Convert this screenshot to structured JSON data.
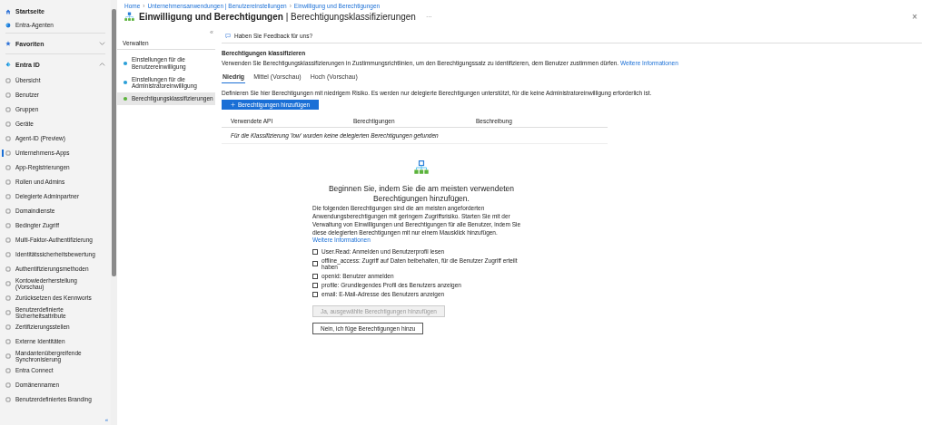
{
  "sidebar": {
    "top_items": [
      {
        "label": "Startseite",
        "kind": "home"
      },
      {
        "label": "Entra-Agenten",
        "kind": "agent"
      }
    ],
    "favorites": {
      "label": "Favoriten",
      "expanded": false
    },
    "section": {
      "label": "Entra ID",
      "expanded": true
    },
    "items": [
      {
        "label": "Übersicht",
        "selected": false
      },
      {
        "label": "Benutzer",
        "selected": false
      },
      {
        "label": "Gruppen",
        "selected": false
      },
      {
        "label": "Geräte",
        "selected": false
      },
      {
        "label": "Agent-ID (Preview)",
        "selected": false
      },
      {
        "label": "Unternehmens-Apps",
        "selected": true
      },
      {
        "label": "App-Registrierungen",
        "selected": false
      },
      {
        "label": "Rollen und Admins",
        "selected": false
      },
      {
        "label": "Delegierte Adminpartner",
        "selected": false
      },
      {
        "label": "Domaindienste",
        "selected": false
      },
      {
        "label": "Bedingter Zugriff",
        "selected": false
      },
      {
        "label": "Multi-Faktor-Authentifizierung",
        "selected": false
      },
      {
        "label": "Identitätssicherheitsbewertung",
        "selected": false
      },
      {
        "label": "Authentifizierungsmethoden",
        "selected": false
      },
      {
        "label": "Kontowiederherstellung (Vorschau)",
        "selected": false
      },
      {
        "label": "Zurücksetzen des Kennworts",
        "selected": false
      },
      {
        "label": "Benutzerdefinierte Sicherheitsattribute",
        "selected": false
      },
      {
        "label": "Zertifizierungsstellen",
        "selected": false
      },
      {
        "label": "Externe Identitäten",
        "selected": false
      },
      {
        "label": "Mandantenübergreifende Synchronisierung",
        "selected": false
      },
      {
        "label": "Entra Connect",
        "selected": false
      },
      {
        "label": "Domänennamen",
        "selected": false
      },
      {
        "label": "Benutzerdefiniertes Branding",
        "selected": false
      }
    ],
    "collapse": "«"
  },
  "breadcrumb": {
    "separator": "›",
    "items": [
      "Home",
      "Unternehmensanwendungen | Benutzereinstellungen",
      "Einwilligung und Berechtigungen"
    ]
  },
  "title": {
    "main": "Einwilligung und Berechtigungen",
    "divider": "|",
    "sub": "Berechtigungsklassifizierungen",
    "more": "···",
    "close": "×"
  },
  "subnav": {
    "collapse": "«",
    "heading": "Verwalten",
    "items": [
      {
        "label": "Einstellungen für die Benutzereinwilligung",
        "selected": false
      },
      {
        "label": "Einstellungen für die Administratoreinwilligung",
        "selected": false
      },
      {
        "label": "Berechtigungsklassifizierungen",
        "selected": true
      }
    ]
  },
  "feedback": "Haben Sie Feedback für uns?",
  "content": {
    "heading": "Berechtigungen klassifizieren",
    "description": "Verwenden Sie Berechtigungsklassifizierungen in Zustimmungsrichtlinien, um den Berechtigungssatz zu identifizieren, dem Benutzer zustimmen dürfen.",
    "description_link": "Weitere Informationen",
    "tabs": [
      {
        "label": "Niedrig",
        "selected": true
      },
      {
        "label": "Mittel (Vorschau)",
        "selected": false
      },
      {
        "label": "Hoch (Vorschau)",
        "selected": false
      }
    ],
    "info": "Definieren Sie hier Berechtigungen mit niedrigem Risiko. Es werden nur delegierte Berechtigungen unterstützt, für die keine Administratoreinwilligung erforderlich ist.",
    "add_button": "Berechtigungen hinzufügen",
    "table": {
      "columns": [
        "Verwendete API",
        "Berechtigungen",
        "Beschreibung"
      ],
      "empty": "Für die Klassifizierung 'low' wurden keine delegierten Berechtigungen gefunden"
    },
    "empty_state": {
      "heading": "Beginnen Sie, indem Sie die am meisten verwendeten Berechtigungen hinzufügen.",
      "text": "Die folgenden Berechtigungen sind die am meisten angeforderten Anwendungsberechtigungen mit geringem Zugriffsrisiko. Starten Sie mit der Verwaltung von Einwilligungen und Berechtigungen für alle Benutzer, indem Sie diese delegierten Berechtigungen mit nur einem Mausklick hinzufügen.",
      "link": "Weitere Informationen",
      "options": [
        {
          "label": "User.Read: Anmelden und Benutzerprofil lesen",
          "checked": false
        },
        {
          "label": "offline_access: Zugriff auf Daten beibehalten, für die Benutzer Zugriff erteilt haben",
          "checked": false
        },
        {
          "label": "openid: Benutzer anmelden",
          "checked": false
        },
        {
          "label": "profile: Grundlegendes Profil des Benutzers anzeigen",
          "checked": false
        },
        {
          "label": "email: E-Mail-Adresse des Benutzers anzeigen",
          "checked": false
        }
      ],
      "buttons": [
        {
          "label": "Ja, ausgewählte Berechtigungen hinzufügen",
          "disabled": true
        },
        {
          "label": "Nein, ich füge Berechtigungen hinzu",
          "disabled": false
        }
      ]
    }
  }
}
